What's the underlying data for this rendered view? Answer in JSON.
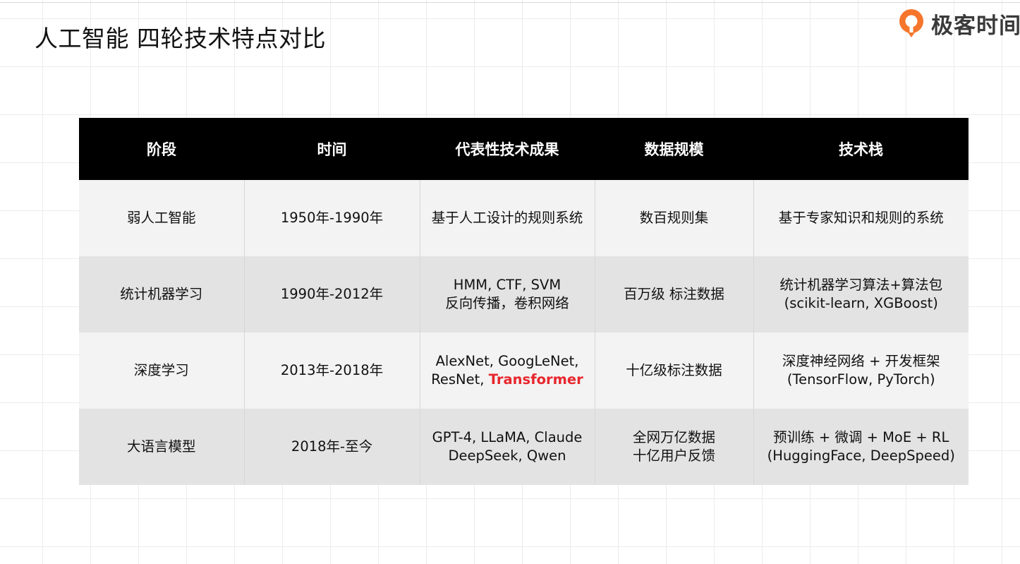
{
  "page_title": "人工智能 四轮技术特点对比",
  "logo": {
    "text": "极客时间",
    "icon": "geektime-logo-icon",
    "brand_color": "#f5752b"
  },
  "table": {
    "header_bg": "#000000",
    "header_fg": "#ffffff",
    "columns": [
      "阶段",
      "时间",
      "代表性技术成果",
      "数据规模",
      "技术栈"
    ],
    "rows": [
      {
        "stage": "弱人工智能",
        "period": "1950年-1990年",
        "achievements": [
          "基于人工设计的规则系统"
        ],
        "data_scale": [
          "数百规则集"
        ],
        "tech_stack": [
          "基于专家知识和规则的系统"
        ]
      },
      {
        "stage": "统计机器学习",
        "period": "1990年-2012年",
        "achievements": [
          "HMM, CTF, SVM",
          "反向传播，卷积网络"
        ],
        "data_scale": [
          "百万级 标注数据"
        ],
        "tech_stack": [
          "统计机器学习算法+算法包",
          "(scikit-learn, XGBoost)"
        ]
      },
      {
        "stage": "深度学习",
        "period": "2013年-2018年",
        "achievements_line1": "AlexNet, GoogLeNet,",
        "achievements_line2_prefix": "ResNet, ",
        "achievements_highlight": "Transformer",
        "highlight_color": "#e8262d",
        "data_scale": [
          "十亿级标注数据"
        ],
        "tech_stack": [
          "深度神经网络 + 开发框架",
          "(TensorFlow, PyTorch)"
        ]
      },
      {
        "stage": "大语言模型",
        "period": "2018年-至今",
        "achievements": [
          "GPT-4,  LLaMA, Claude",
          "DeepSeek, Qwen"
        ],
        "data_scale": [
          "全网万亿数据",
          "十亿用户反馈"
        ],
        "tech_stack": [
          "预训练 + 微调 + MoE + RL",
          "(HuggingFace, DeepSpeed)"
        ]
      }
    ]
  }
}
